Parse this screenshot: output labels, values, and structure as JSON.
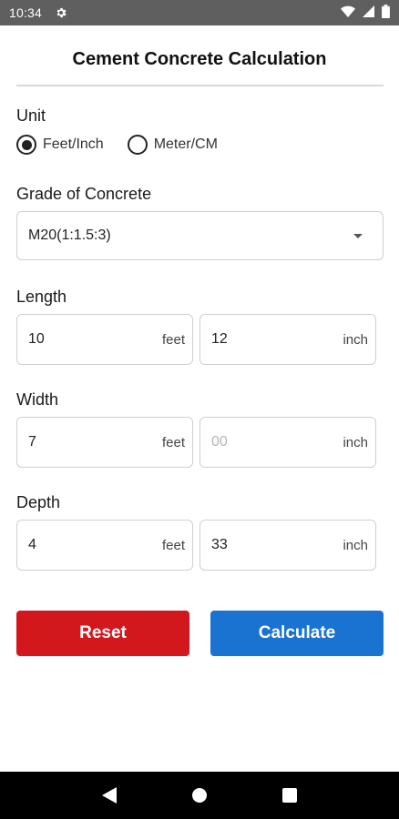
{
  "status_bar": {
    "time": "10:34"
  },
  "title": "Cement Concrete Calculation",
  "unit": {
    "label": "Unit",
    "options": [
      {
        "label": "Feet/Inch",
        "selected": true
      },
      {
        "label": "Meter/CM",
        "selected": false
      }
    ]
  },
  "grade": {
    "label": "Grade of Concrete",
    "selected": "M20(1:1.5:3)"
  },
  "length": {
    "label": "Length",
    "feet_value": "10",
    "feet_unit": "feet",
    "inch_value": "12",
    "inch_unit": "inch"
  },
  "width": {
    "label": "Width",
    "feet_value": "7",
    "feet_unit": "feet",
    "inch_placeholder": "00",
    "inch_unit": "inch"
  },
  "depth": {
    "label": "Depth",
    "feet_value": "4",
    "feet_unit": "feet",
    "inch_value": "33",
    "inch_unit": "inch"
  },
  "buttons": {
    "reset": "Reset",
    "calculate": "Calculate"
  },
  "colors": {
    "reset": "#d2181c",
    "calculate": "#1a73d1",
    "status_bar": "#5f5f5f"
  },
  "icons": {
    "status_settings": "gear-icon",
    "status_wifi": "wifi-icon",
    "status_signal": "signal-icon",
    "status_battery": "battery-icon",
    "nav_back": "back-triangle-icon",
    "nav_home": "home-circle-icon",
    "nav_recents": "recents-square-icon"
  }
}
